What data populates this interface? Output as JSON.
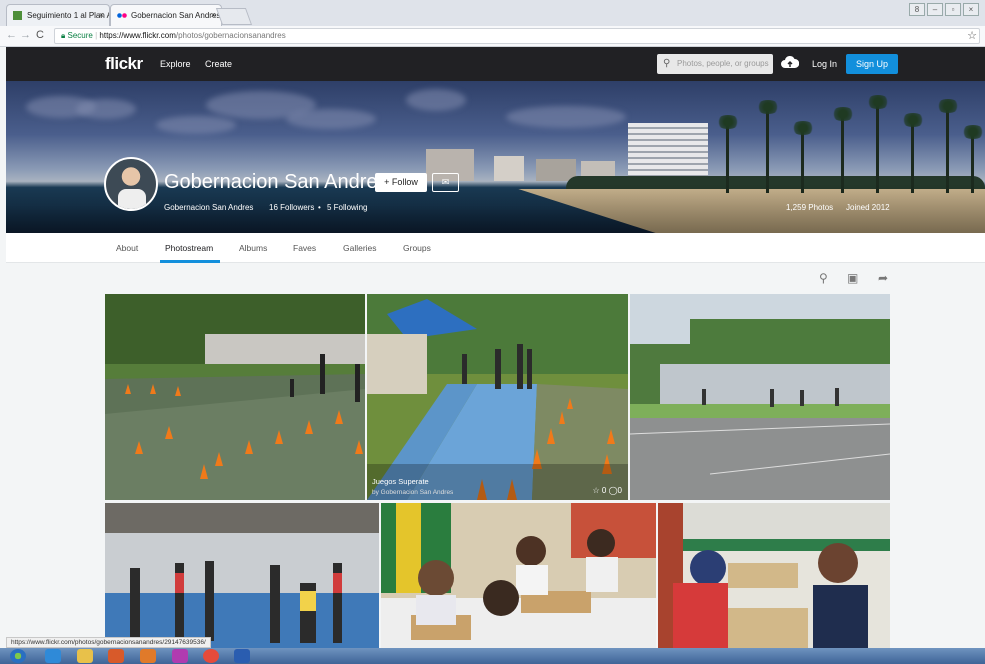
{
  "browser": {
    "tabs": [
      {
        "label": "Seguimiento 1 al Plan A",
        "close": "×"
      },
      {
        "label": "Gobernacion San Andres",
        "close": "×"
      }
    ],
    "secure_label": "Secure",
    "url_host": "https://www.flickr.com",
    "url_path": "/photos/gobernacionsanandres",
    "status_url": "https://www.flickr.com/photos/gobernacionsanandres/29147639536/"
  },
  "header": {
    "logo": "flickr",
    "nav": [
      "Explore",
      "Create"
    ],
    "search_placeholder": "Photos, people, or groups",
    "login": "Log In",
    "signup": "Sign Up"
  },
  "profile": {
    "name": "Gobernacion San Andres",
    "follow_label": "+ Follow",
    "mail_glyph": "✉",
    "username": "Gobernacion San Andres",
    "followers": "16 Followers",
    "separator": "•",
    "following": "5 Following",
    "photos": "1,259 Photos",
    "joined": "Joined 2012"
  },
  "subnav": {
    "items": [
      "About",
      "Photostream",
      "Albums",
      "Faves",
      "Galleries",
      "Groups"
    ],
    "active": "Photostream"
  },
  "photos": [
    {
      "title": "",
      "by": ""
    },
    {
      "title": "Juegos Superate",
      "by": "by Gobernacion San Andres",
      "faves": "0",
      "comments": "0"
    },
    {
      "title": "",
      "by": ""
    },
    {
      "title": "",
      "by": ""
    },
    {
      "title": "",
      "by": ""
    },
    {
      "title": "",
      "by": ""
    }
  ],
  "colors": {
    "accent": "#128fdc",
    "header_bg": "#212124"
  }
}
